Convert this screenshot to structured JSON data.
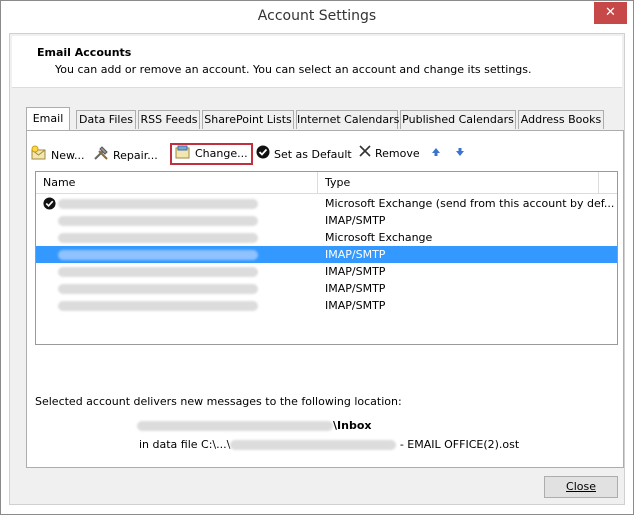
{
  "window": {
    "title": "Account Settings",
    "close_glyph": "✕"
  },
  "header": {
    "title": "Email Accounts",
    "description": "You can add or remove an account. You can select an account and change its settings."
  },
  "tabs": [
    {
      "label": "Email",
      "active": true
    },
    {
      "label": "Data Files",
      "active": false
    },
    {
      "label": "RSS Feeds",
      "active": false
    },
    {
      "label": "SharePoint Lists",
      "active": false
    },
    {
      "label": "Internet Calendars",
      "active": false
    },
    {
      "label": "Published Calendars",
      "active": false
    },
    {
      "label": "Address Books",
      "active": false
    }
  ],
  "toolbar": {
    "new_label": "New...",
    "repair_label": "Repair...",
    "change_label": "Change...",
    "set_default_label": "Set as Default",
    "remove_label": "Remove",
    "up_icon": "arrow-up-icon",
    "down_icon": "arrow-down-icon"
  },
  "accounts_list": {
    "columns": [
      "Name",
      "Type"
    ],
    "rows": [
      {
        "type": "Microsoft Exchange (send from this account by def...",
        "default": true,
        "selected": false
      },
      {
        "type": "IMAP/SMTP",
        "default": false,
        "selected": false
      },
      {
        "type": "Microsoft Exchange",
        "default": false,
        "selected": false
      },
      {
        "type": "IMAP/SMTP",
        "default": false,
        "selected": true
      },
      {
        "type": "IMAP/SMTP",
        "default": false,
        "selected": false
      },
      {
        "type": "IMAP/SMTP",
        "default": false,
        "selected": false
      },
      {
        "type": "IMAP/SMTP",
        "default": false,
        "selected": false
      }
    ]
  },
  "delivery": {
    "label": "Selected account delivers new messages to the following location:",
    "folder_suffix": "\\Inbox",
    "file_prefix": "in data file C:\\...\\",
    "file_suffix": " - EMAIL OFFICE(2).ost"
  },
  "footer": {
    "close_label": "Close"
  },
  "colors": {
    "selection": "#3399ff",
    "highlight_border": "#c0313f",
    "close_red": "#c74848"
  }
}
